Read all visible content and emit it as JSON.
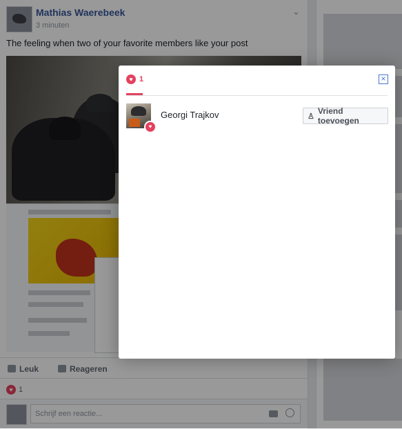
{
  "post": {
    "author": "Mathias Waerebeek",
    "time": "3 minuten",
    "text": "The feeling when two of your favorite members like your post",
    "actions": {
      "like": "Leuk",
      "comment": "Reageren"
    },
    "reaction_count": "1",
    "comment_placeholder": "Schrijf een reactie..."
  },
  "dialog": {
    "tab_count": "1",
    "close_symbol": "×",
    "people": [
      {
        "name": "Georgi Trajkov",
        "button_label": "Vriend toevoegen"
      }
    ]
  },
  "icons": {
    "heart": "heart-icon",
    "close": "close-icon",
    "add_friend": "add-friend-icon",
    "camera": "camera-icon",
    "emoji": "emoji-icon",
    "like": "thumbs-up-icon",
    "comment": "comment-icon",
    "chevron": "chevron-down-icon"
  },
  "colors": {
    "accent_reaction": "#e4415e",
    "link": "#365899",
    "close_border": "#4a76d1"
  }
}
